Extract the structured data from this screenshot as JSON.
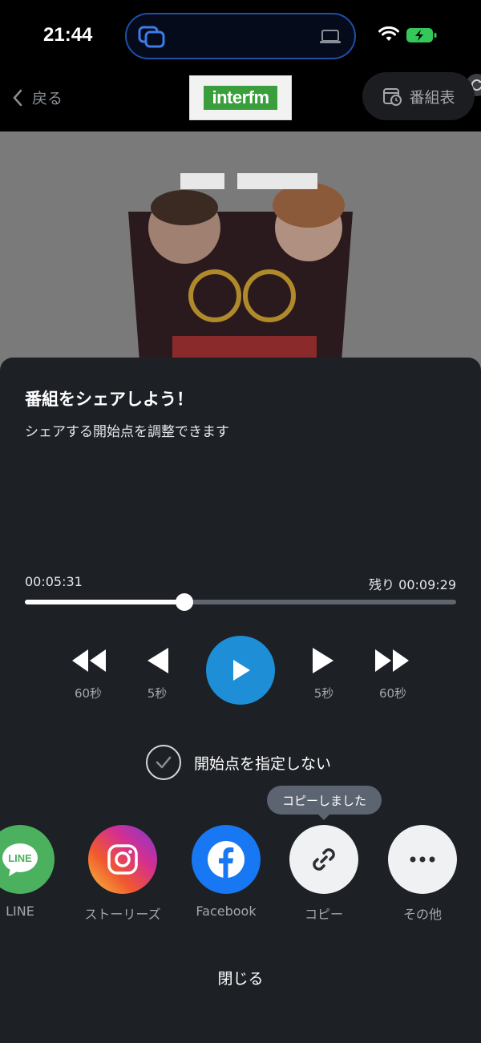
{
  "status": {
    "time": "21:44"
  },
  "header": {
    "back_label": "戻る",
    "logo_text": "interfm",
    "schedule_label": "番組表"
  },
  "sheet": {
    "title": "番組をシェアしよう！",
    "subtitle": "シェアする開始点を調整できます",
    "position_time": "00:05:31",
    "remaining_time": "残り 00:09:29",
    "progress": 0.37,
    "controls": {
      "rewind60": "60秒",
      "rewind5": "5秒",
      "forward5": "5秒",
      "forward60": "60秒"
    },
    "no_start_label": "開始点を指定しない",
    "tooltip": "コピーしました",
    "share_targets": [
      {
        "label": "LINE",
        "icon": "line-icon"
      },
      {
        "label": "ストーリーズ",
        "icon": "instagram-icon"
      },
      {
        "label": "Facebook",
        "icon": "facebook-icon"
      },
      {
        "label": "コピー",
        "icon": "link-icon"
      },
      {
        "label": "その他",
        "icon": "more-icon"
      }
    ],
    "close_label": "閉じる"
  },
  "colors": {
    "accent": "#1e8fd6",
    "sheet_bg": "#1d2025",
    "line_green": "#4cb15e",
    "facebook_blue": "#1877f2"
  }
}
